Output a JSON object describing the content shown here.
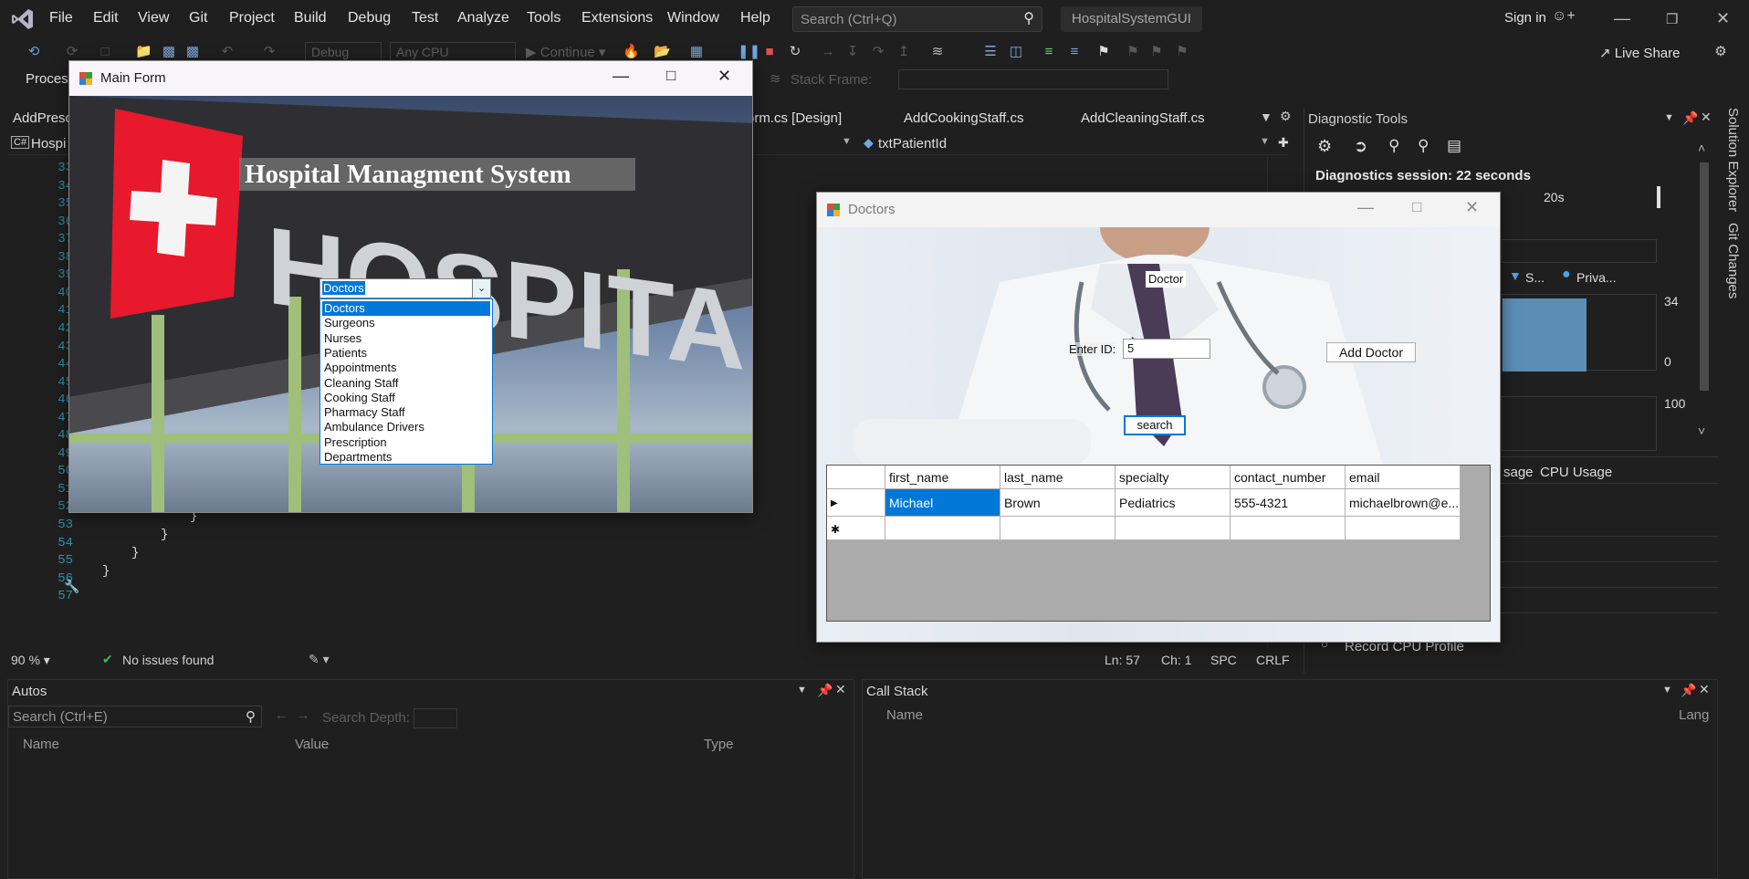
{
  "vs": {
    "menu": [
      "File",
      "Edit",
      "View",
      "Git",
      "Project",
      "Build",
      "Debug",
      "Test",
      "Analyze",
      "Tools",
      "Extensions",
      "Window",
      "Help"
    ],
    "search_placeholder": "Search (Ctrl+Q)",
    "solution_name": "HospitalSystemGUI",
    "sign_in": "Sign in",
    "live_share": "Live Share",
    "toolbar": {
      "config": "Debug",
      "platform": "Any CPU",
      "continue": "Continue",
      "process_label": "Process",
      "stack_frame_label": "Stack Frame:"
    },
    "tabs": [
      "AddPresc",
      "orm.cs [Design]",
      "AddCookingStaff.cs",
      "AddCleaningStaff.cs"
    ],
    "nav": {
      "left": "Hospi",
      "member": "txtPatientId"
    },
    "line_numbers": [
      "33",
      "34",
      "35",
      "36",
      "37",
      "38",
      "39",
      "40",
      "41",
      "42",
      "43",
      "44",
      "45",
      "46",
      "47",
      "48",
      "49",
      "50",
      "51",
      "52",
      "53",
      "54",
      "55",
      "56",
      "57"
    ],
    "status": {
      "zoom": "90 %",
      "issues": "No issues found",
      "ln": "Ln: 57",
      "ch": "Ch: 1",
      "spc": "SPC",
      "crlf": "CRLF"
    },
    "autos": {
      "title": "Autos",
      "search_placeholder": "Search (Ctrl+E)",
      "search_depth": "Search Depth:",
      "columns": [
        "Name",
        "Value",
        "Type"
      ]
    },
    "callstack": {
      "title": "Call Stack",
      "columns": [
        "Name",
        "Lang"
      ]
    },
    "diagnostic": {
      "title": "Diagnostic Tools",
      "session": "Diagnostics session: 22 seconds",
      "timeline_label": "20s",
      "legend": [
        "S...",
        "Priva..."
      ],
      "chart_top": "34",
      "chart_zero": "0",
      "chart_hundred": "100",
      "tabs": [
        "sage",
        "CPU Usage"
      ],
      "record": "Record CPU Profile"
    },
    "side": [
      "Solution Explorer",
      "Git Changes"
    ]
  },
  "main_form": {
    "title": "Main Form",
    "heading": "Hospital Managment System",
    "sign_text": "HOSPITAL",
    "combo_value": "Doctors",
    "dropdown": [
      "Doctors",
      "Surgeons",
      "Nurses",
      "Patients",
      "Appointments",
      "Cleaning Staff",
      "Cooking Staff",
      "Pharmacy Staff",
      "Ambulance Drivers",
      "Prescription",
      "Departments"
    ]
  },
  "doctors_form": {
    "title": "Doctors",
    "label": "Doctor",
    "enter_id_label": "Enter ID:",
    "id_value": "5",
    "add_button": "Add Doctor",
    "search_button": "search",
    "columns": [
      "first_name",
      "last_name",
      "specialty",
      "contact_number",
      "email"
    ],
    "rows": [
      [
        "Michael",
        "Brown",
        "Pediatrics",
        "555-4321",
        "michaelbrown@e..."
      ]
    ]
  }
}
